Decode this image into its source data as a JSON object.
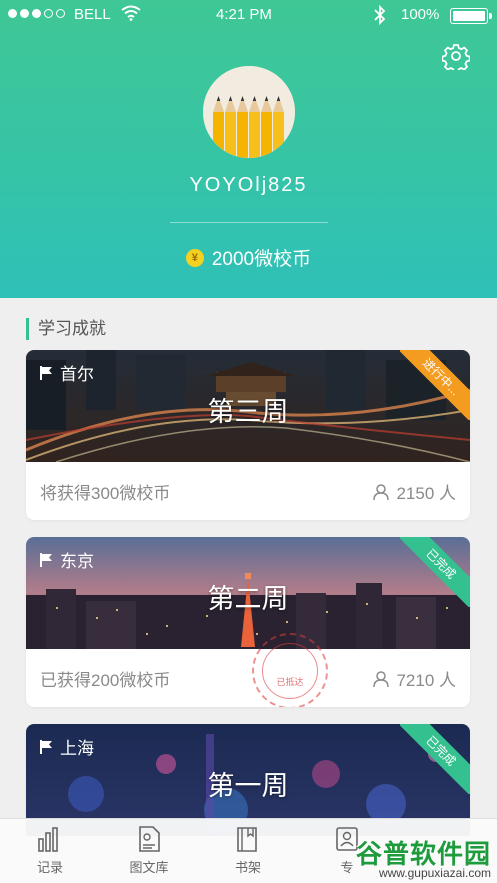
{
  "status_bar": {
    "carrier": "BELL",
    "time": "4:21 PM",
    "battery": "100%"
  },
  "profile": {
    "username": "YOYOlj825",
    "coin_symbol": "¥",
    "coins": "2000微校币"
  },
  "section": {
    "title": "学习成就"
  },
  "cards": [
    {
      "city": "首尔",
      "week": "第三周",
      "info": "将获得300微校币",
      "people": "2150 人",
      "badge": "进行中...",
      "badge_color": "#f39c1f"
    },
    {
      "city": "东京",
      "week": "第二周",
      "info": "已获得200微校币",
      "people": "7210 人",
      "badge": "已完成",
      "badge_color": "#35c08f",
      "stamp": "已抵达"
    },
    {
      "city": "上海",
      "week": "第一周",
      "badge": "已完成",
      "badge_color": "#35c08f"
    }
  ],
  "tabbar": {
    "items": [
      {
        "label": "记录",
        "icon": "bar-chart-icon"
      },
      {
        "label": "图文库",
        "icon": "document-icon"
      },
      {
        "label": "书架",
        "icon": "book-icon"
      },
      {
        "label": "专",
        "icon": "profile-icon"
      }
    ]
  },
  "watermark": {
    "title": "谷普软件园",
    "url": "www.gupuxiazai.com"
  },
  "colors": {
    "accent": "#35c08f",
    "header_top": "#3fc795",
    "header_bottom": "#2fc0b8",
    "badge_orange": "#f39c1f"
  }
}
